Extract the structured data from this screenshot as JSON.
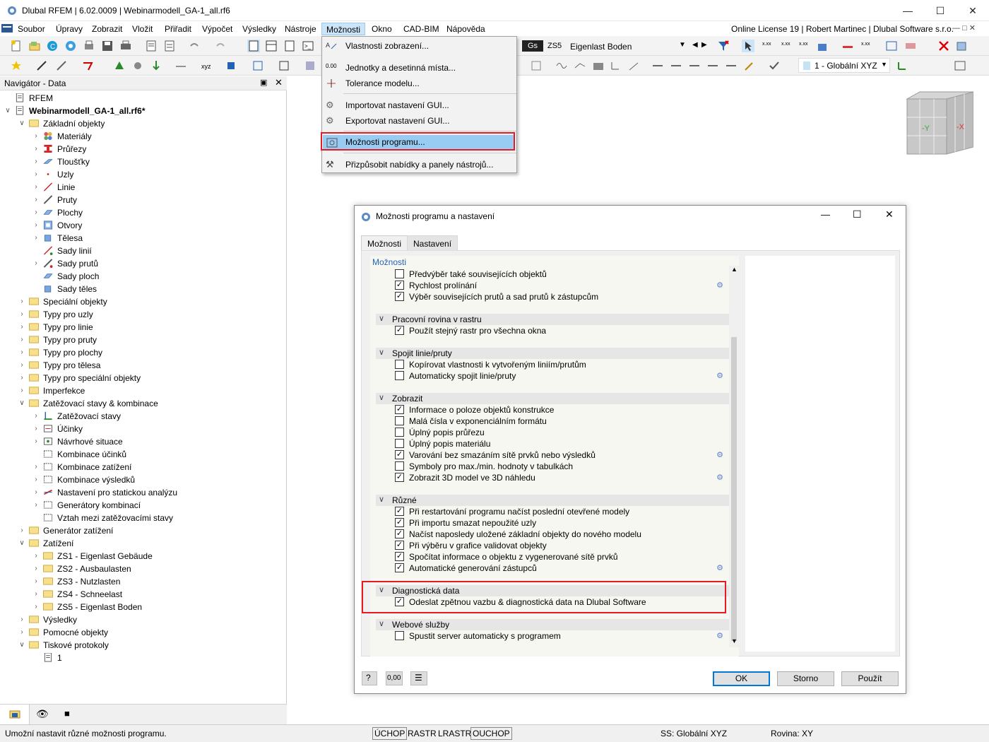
{
  "window": {
    "title": "Dlubal RFEM | 6.02.0009 | Webinarmodell_GA-1_all.rf6",
    "minimize_icon": "minimize-icon",
    "maximize_icon": "maximize-icon",
    "close_icon": "close-icon"
  },
  "menubar": {
    "items": [
      "Soubor",
      "Úpravy",
      "Zobrazit",
      "Vložit",
      "Přiřadit",
      "Výpočet",
      "Výsledky",
      "Nástroje",
      "Možnosti",
      "Okno",
      "CAD-BIM",
      "Nápověda"
    ],
    "license": "Online License 19 | Robert Martinec | Dlubal Software s.r.o."
  },
  "toolbar": {
    "gs_label": "Gs",
    "zs_label": "ZS5",
    "loadcase": "Eigenlast Boden",
    "cs_label": "1 - Globální XYZ"
  },
  "dropdown": {
    "items": [
      "Vlastnosti zobrazení...",
      "Jednotky a desetinná místa...",
      "Tolerance modelu...",
      "Importovat nastavení GUI...",
      "Exportovat nastavení GUI...",
      "Možnosti programu...",
      "Přizpůsobit nabídky a panely nástrojů..."
    ],
    "units_icon_text": "0.00"
  },
  "navigator": {
    "title": "Navigátor - Data",
    "root": "RFEM",
    "model": "Webinarmodell_GA-1_all.rf6*",
    "tree": [
      "Základní objekty",
      "Materiály",
      "Průřezy",
      "Tloušťky",
      "Uzly",
      "Linie",
      "Pruty",
      "Plochy",
      "Otvory",
      "Tělesa",
      "Sady linií",
      "Sady prutů",
      "Sady ploch",
      "Sady těles",
      "Speciální objekty",
      "Typy pro uzly",
      "Typy pro linie",
      "Typy pro pruty",
      "Typy pro plochy",
      "Typy pro tělesa",
      "Typy pro speciální objekty",
      "Imperfekce",
      "Zatěžovací stavy & kombinace",
      "Zatěžovací stavy",
      "Účinky",
      "Návrhové situace",
      "Kombinace účinků",
      "Kombinace zatížení",
      "Kombinace výsledků",
      "Nastavení pro statickou analýzu",
      "Generátory kombinací",
      "Vztah mezi zatěžovacími stavy",
      "Generátor zatížení",
      "Zatížení",
      "ZS1 - Eigenlast Gebäude",
      "ZS2 - Ausbaulasten",
      "ZS3 - Nutzlasten",
      "ZS4 - Schneelast",
      "ZS5 - Eigenlast Boden",
      "Výsledky",
      "Pomocné objekty",
      "Tiskové protokoly",
      "1"
    ]
  },
  "cube": {
    "face_front": "-Y",
    "face_right": "-X"
  },
  "dialog": {
    "title": "Možnosti programu a nastavení",
    "tabs": [
      "Možnosti",
      "Nastavení"
    ],
    "section": "Možnosti",
    "groups": [
      "Pracovní rovina v rastru",
      "Spojit linie/pruty",
      "Zobrazit",
      "Různé",
      "Diagnostická data",
      "Webové služby"
    ],
    "options": [
      "Předvýběr také souvisejících objektů",
      "Rychlost prolínání",
      "Výběr souvisejících prutů a sad prutů k zástupcům",
      "Použít stejný rastr pro všechna okna",
      "Kopírovat vlastnosti k vytvořeným liniím/prutům",
      "Automaticky spojit linie/pruty",
      "Informace o poloze objektů konstrukce",
      "Malá čísla v exponenciálním formátu",
      "Úplný popis průřezu",
      "Úplný popis materiálu",
      "Varování bez smazáním sítě prvků nebo výsledků",
      "Symboly pro max./min. hodnoty v tabulkách",
      "Zobrazit 3D model ve 3D náhledu",
      "Při restartování programu načíst poslední otevřené modely",
      "Při importu smazat nepoužité uzly",
      "Načíst naposledy uložené základní objekty do nového modelu",
      "Při výběru v grafice validovat objekty",
      "Spočítat informace o objektu z vygenerované sítě prvků",
      "Automatické generování zástupců",
      "Odeslat zpětnou vazbu & diagnostická data na Dlubal Software",
      "Spustit server automaticky s programem"
    ],
    "footer_units": "0,00",
    "buttons": [
      "OK",
      "Storno",
      "Použít"
    ]
  },
  "status": {
    "message": "Umožní nastavit různé možnosti programu.",
    "snap": [
      "ÚCHOP",
      "RASTR",
      "LRASTR",
      "OUCHOP"
    ],
    "cs": "SS: Globální XYZ",
    "plane": "Rovina: XY"
  }
}
